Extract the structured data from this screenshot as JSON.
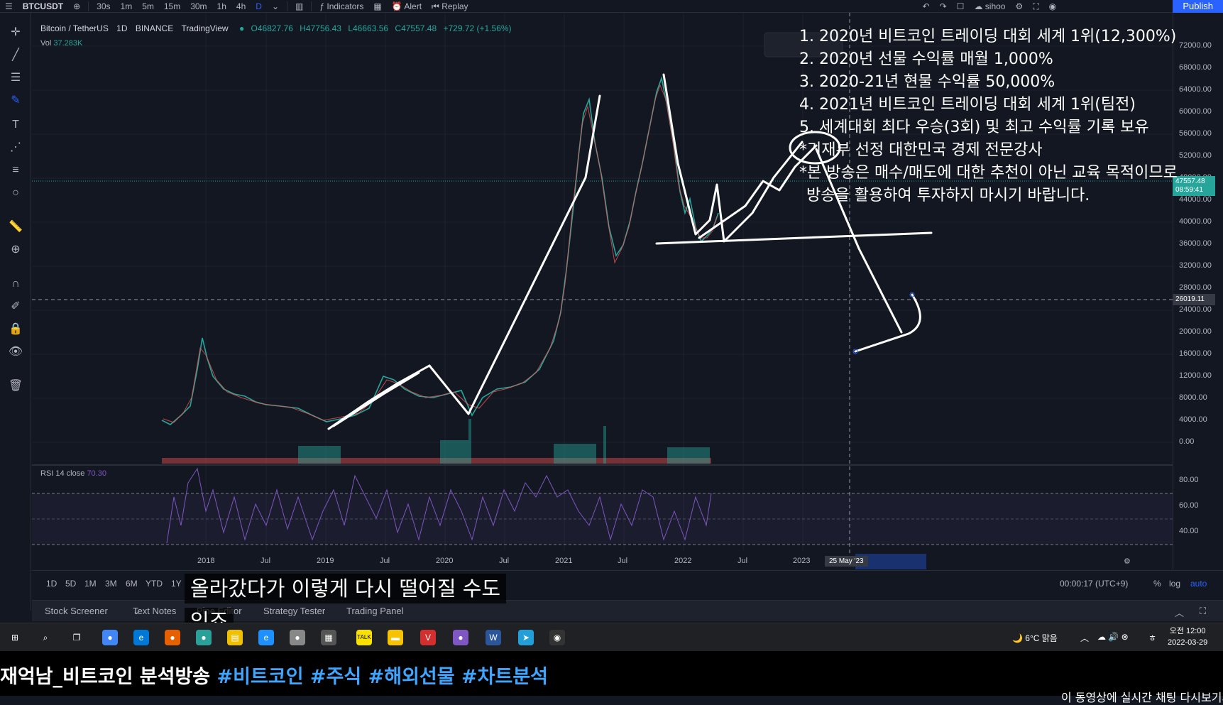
{
  "toolbar": {
    "symbol": "BTCUSDT",
    "intervals": [
      "30s",
      "1m",
      "5m",
      "15m",
      "30m",
      "1h",
      "4h",
      "D"
    ],
    "indicators_label": "Indicators",
    "alert_label": "Alert",
    "replay_label": "Replay",
    "user_label": "sihoo",
    "publish_label": "Publish"
  },
  "legend": {
    "symbol_title": "Bitcoin / TetherUS",
    "interval": "1D",
    "exchange": "BINANCE",
    "source": "TradingView",
    "open": "O46827.76",
    "high": "H47756.43",
    "low": "L46663.56",
    "close": "C47557.48",
    "change": "+729.72 (+1.56%)",
    "vol_label": "Vol",
    "vol_value": "37.283K",
    "rsi_label": "RSI 14 close",
    "rsi_value": "70.30"
  },
  "price_scale": {
    "labels": [
      "72000.00",
      "68000.00",
      "64000.00",
      "60000.00",
      "56000.00",
      "52000.00",
      "48000.00",
      "44000.00",
      "40000.00",
      "36000.00",
      "32000.00",
      "28000.00",
      "24000.00",
      "20000.00",
      "16000.00",
      "12000.00",
      "8000.00",
      "4000.00",
      "0.00"
    ],
    "last_price": "47557.48",
    "last_time": "08:59:41",
    "crosshair_price": "26019.11",
    "rsi_labels": [
      "80.00",
      "60.00",
      "40.00"
    ]
  },
  "time_axis": {
    "labels": [
      "2018",
      "Jul",
      "2019",
      "Jul",
      "2020",
      "Jul",
      "2021",
      "Jul",
      "2022",
      "Jul",
      "2023"
    ],
    "crosshair_time": "25 May '23"
  },
  "bottom": {
    "ranges": [
      "1D",
      "5D",
      "1M",
      "3M",
      "6M",
      "YTD",
      "1Y"
    ],
    "clock": "00:00:17 (UTC+9)",
    "percent_label": "%",
    "log_label": "log",
    "auto_label": "auto"
  },
  "panel_tabs": [
    "Stock Screener",
    "Text Notes",
    "Pine Editor",
    "Strategy Tester",
    "Trading Panel"
  ],
  "overlay_lines": [
    "1. 2020년 비트코인 트레이딩 대회 세계 1위(12,300%)",
    "2. 2020년 선물 수익률 매월 1,000%",
    "3. 2020-21년 현물 수익률 50,000%",
    "4. 2021년 비트코인 트레이딩 대회 세계 1위(팀전)",
    "5. 세계대회 최다 우승(3회) 및 최고 수익률 기록 보유",
    "*기재부 선정 대한민국 경제 전문강사",
    "*본 방송은 매수/매도에 대한 추천이 아닌 교육 목적이므로",
    "방송을 활용하여 투자하지 마시기 바랍니다."
  ],
  "subtitle_line1": "올라갔다가 이렇게 다시 떨어질 수도",
  "subtitle_line2": "있죠",
  "taskbar": {
    "weather": "6°C 맑음",
    "ime": "ㅎ",
    "time": "오전 12:00",
    "date": "2022-03-29"
  },
  "footer": {
    "title_prefix": "재억남_비트코인 분석방송 ",
    "tags": "#비트코인 #주식 #해외선물 #차트분석",
    "note": "이 동영상에 실시간 채팅 다시보기가"
  },
  "colors": {
    "up": "#26a69a",
    "down": "#ef5350",
    "rsi": "#7e57c2",
    "accent": "#2962ff",
    "background": "#131722"
  }
}
